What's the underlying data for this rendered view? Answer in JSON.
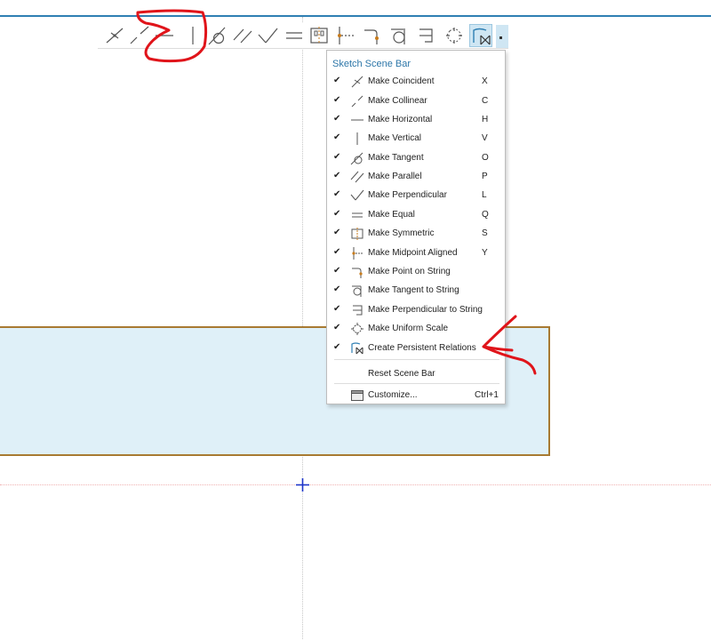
{
  "colors": {
    "accent": "#2f7fb3",
    "sketch_fill": "#dff0f8",
    "sketch_border": "#a87a32",
    "annotation": "#e0141a",
    "origin": "#1d35c9"
  },
  "scene_bar": {
    "buttons": [
      {
        "icon": "coincident-icon"
      },
      {
        "icon": "collinear-icon"
      },
      {
        "icon": "horizontal-icon"
      },
      {
        "icon": "vertical-icon"
      },
      {
        "icon": "tangent-icon"
      },
      {
        "icon": "parallel-icon"
      },
      {
        "icon": "perpendicular-icon"
      },
      {
        "icon": "equal-icon"
      },
      {
        "icon": "symmetric-icon"
      },
      {
        "icon": "midpoint-aligned-icon"
      },
      {
        "icon": "point-on-string-icon"
      },
      {
        "icon": "tangent-to-string-icon"
      },
      {
        "icon": "perpendicular-to-string-icon"
      },
      {
        "icon": "uniform-scale-icon"
      },
      {
        "icon": "persistent-relations-icon",
        "active": true
      }
    ]
  },
  "menu": {
    "title": "Sketch Scene Bar",
    "items": [
      {
        "label": "Make Coincident",
        "shortcut": "X",
        "checked": "✔",
        "icon": "coincident-icon"
      },
      {
        "label": "Make Collinear",
        "shortcut": "C",
        "checked": "✔",
        "icon": "collinear-icon"
      },
      {
        "label": "Make Horizontal",
        "shortcut": "H",
        "checked": "✔",
        "icon": "horizontal-icon"
      },
      {
        "label": "Make Vertical",
        "shortcut": "V",
        "checked": "✔",
        "icon": "vertical-icon"
      },
      {
        "label": "Make Tangent",
        "shortcut": "O",
        "checked": "✔",
        "icon": "tangent-icon"
      },
      {
        "label": "Make Parallel",
        "shortcut": "P",
        "checked": "✔",
        "icon": "parallel-icon"
      },
      {
        "label": "Make Perpendicular",
        "shortcut": "L",
        "checked": "✔",
        "icon": "perpendicular-icon"
      },
      {
        "label": "Make Equal",
        "shortcut": "Q",
        "checked": "✔",
        "icon": "equal-icon"
      },
      {
        "label": "Make Symmetric",
        "shortcut": "S",
        "checked": "✔",
        "icon": "symmetric-icon"
      },
      {
        "label": "Make Midpoint Aligned",
        "shortcut": "Y",
        "checked": "✔",
        "icon": "midpoint-aligned-icon"
      },
      {
        "label": "Make Point on String",
        "shortcut": "",
        "checked": "✔",
        "icon": "point-on-string-icon"
      },
      {
        "label": "Make Tangent to String",
        "shortcut": "",
        "checked": "✔",
        "icon": "tangent-to-string-icon"
      },
      {
        "label": "Make Perpendicular to String",
        "shortcut": "",
        "checked": "✔",
        "icon": "perpendicular-to-string-icon"
      },
      {
        "label": "Make Uniform Scale",
        "shortcut": "",
        "checked": "✔",
        "icon": "uniform-scale-icon"
      },
      {
        "label": "Create Persistent Relations",
        "shortcut": "",
        "checked": "✔",
        "icon": "persistent-relations-icon"
      }
    ],
    "reset": {
      "label": "Reset Scene Bar"
    },
    "customize": {
      "label": "Customize...",
      "shortcut": "Ctrl+1",
      "icon": "customize-icon"
    }
  }
}
